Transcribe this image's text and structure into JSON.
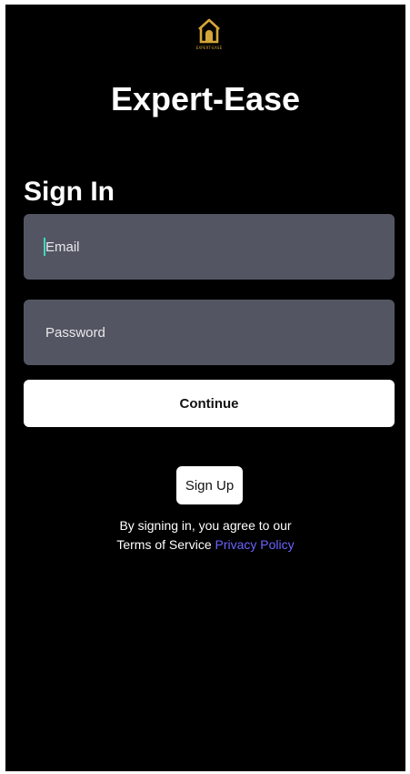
{
  "brand": {
    "app_name": "Expert-Ease",
    "logo_text": "EXPERT-EASE",
    "logo_icon": "house-icon",
    "accent_gold": "#d4a537"
  },
  "auth": {
    "heading": "Sign In",
    "email_placeholder": "Email",
    "password_placeholder": "Password",
    "continue_label": "Continue",
    "signup_label": "Sign Up"
  },
  "legal": {
    "agree_text": "By signing in, you agree to our",
    "terms_text": "Terms of Service",
    "privacy_text": "Privacy Policy",
    "link_color": "#6b63ff"
  }
}
